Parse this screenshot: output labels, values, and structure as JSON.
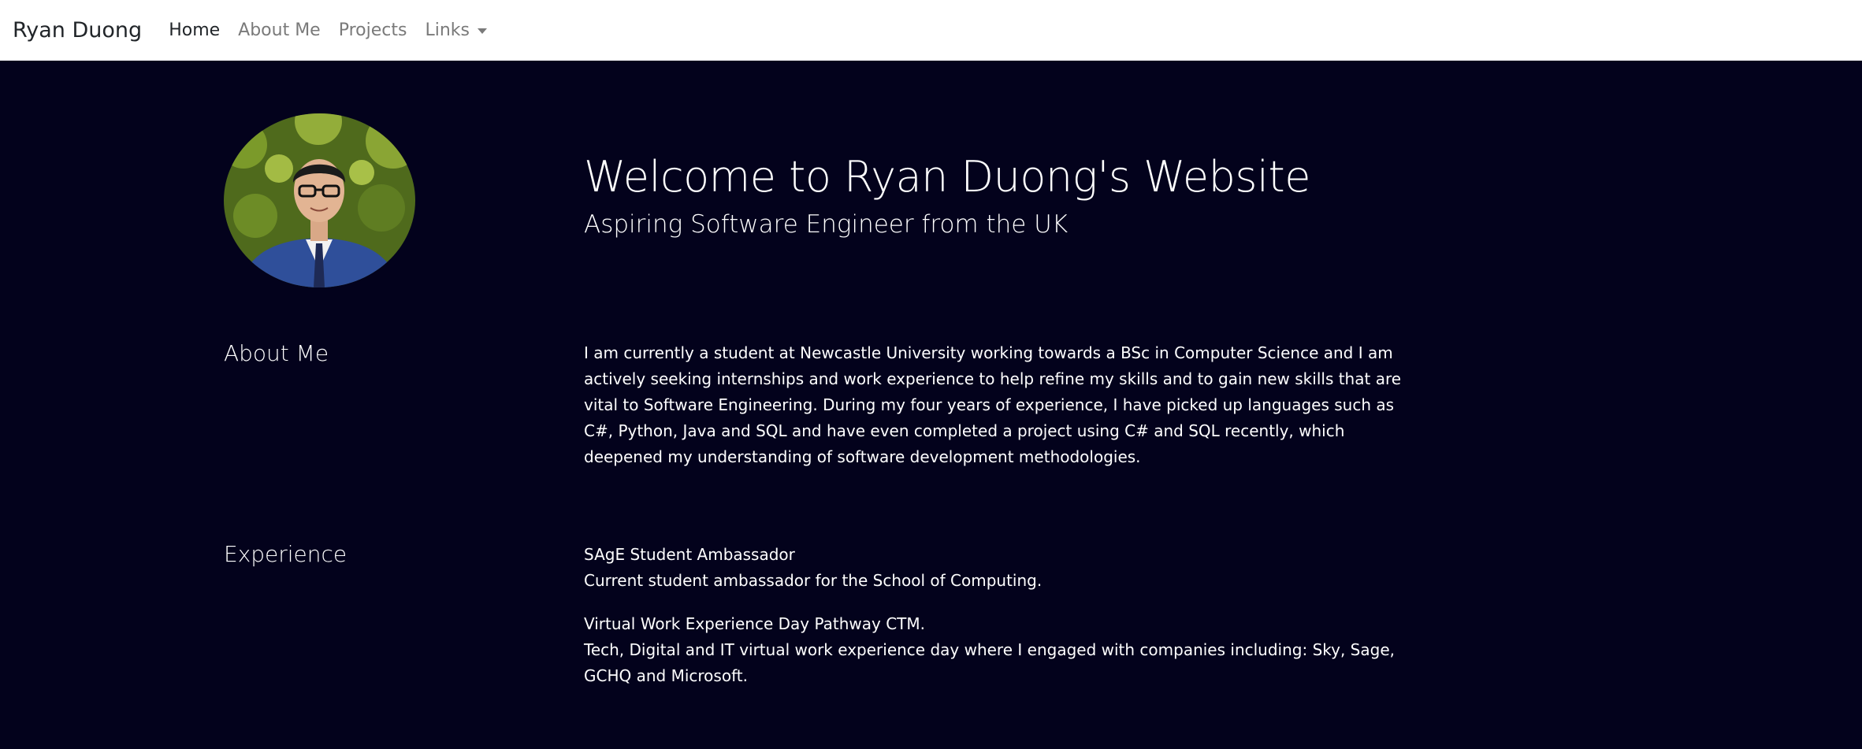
{
  "navbar": {
    "brand": "Ryan Duong",
    "items": [
      {
        "label": "Home"
      },
      {
        "label": "About Me"
      },
      {
        "label": "Projects"
      },
      {
        "label": "Links"
      }
    ]
  },
  "hero": {
    "title": "Welcome to Ryan Duong's Website",
    "subtitle": "Aspiring Software Engineer from the UK"
  },
  "about": {
    "heading": "About Me",
    "text": "I am currently a student at Newcastle University working towards a BSc in Computer Science and I am actively seeking internships and work experience to help refine my skills and to gain new skills that are vital to Software Engineering. During my four years of experience, I have picked up languages such as C#, Python, Java and SQL and have even completed a project using C# and SQL recently, which deepened my understanding of software development methodologies."
  },
  "experience": {
    "heading": "Experience",
    "items": [
      {
        "title": "SAgE Student Ambassador",
        "description": "Current student ambassador for the School of Computing."
      },
      {
        "title": "Virtual Work Experience Day Pathway CTM.",
        "description": "Tech, Digital and IT virtual work experience day where I engaged with companies including: Sky, Sage, GCHQ and Microsoft."
      }
    ]
  },
  "colors": {
    "background": "#03021c",
    "navbar": "#ffffff",
    "text": "#ffffff"
  }
}
